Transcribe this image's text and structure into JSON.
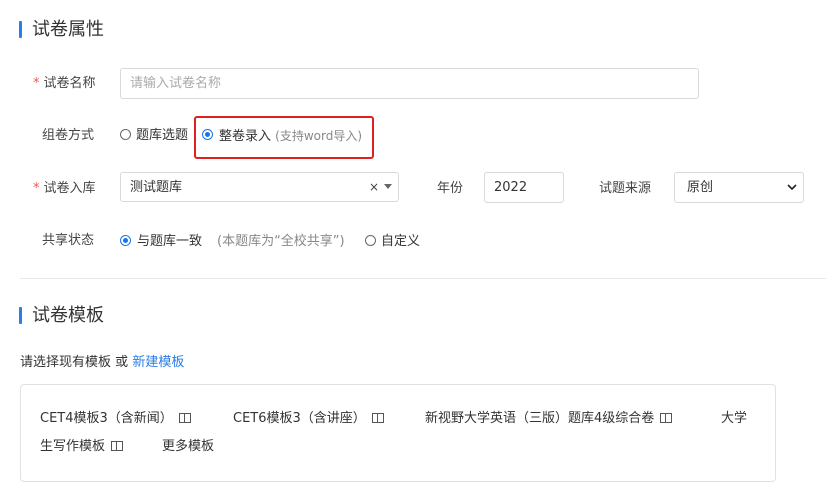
{
  "section_props": {
    "title": "试卷属性"
  },
  "form": {
    "name": {
      "label": "试卷名称",
      "required_mark": "*",
      "placeholder": "请输入试卷名称"
    },
    "method": {
      "label": "组卷方式",
      "option_bank": "题库选题",
      "option_whole": "整卷录入",
      "whole_hint": "(支持word导入)",
      "selected": "整卷录入"
    },
    "bank": {
      "label": "试卷入库",
      "required_mark": "*",
      "value": "测试题库",
      "clear": "×"
    },
    "year": {
      "label": "年份",
      "value": "2022"
    },
    "source": {
      "label": "试题来源",
      "value": "原创",
      "options": [
        "原创"
      ]
    },
    "share": {
      "label": "共享状态",
      "option_same": "与题库一致",
      "note": "(本题库为“全校共享”)",
      "option_custom": "自定义",
      "selected": "与题库一致"
    }
  },
  "section_template": {
    "title": "试卷模板",
    "prompt": "请选择现有模板",
    "or": "或",
    "new_link": "新建模板",
    "templates": [
      "CET4模板3（含新闻）",
      "CET6模板3（含讲座）",
      "新视野大学英语（三版）题库4级综合卷",
      "大学",
      "生写作模板"
    ],
    "more_link": "更多模板"
  },
  "colors": {
    "accent": "#2b7de9",
    "highlight": "#e02020",
    "required": "#e55555"
  }
}
